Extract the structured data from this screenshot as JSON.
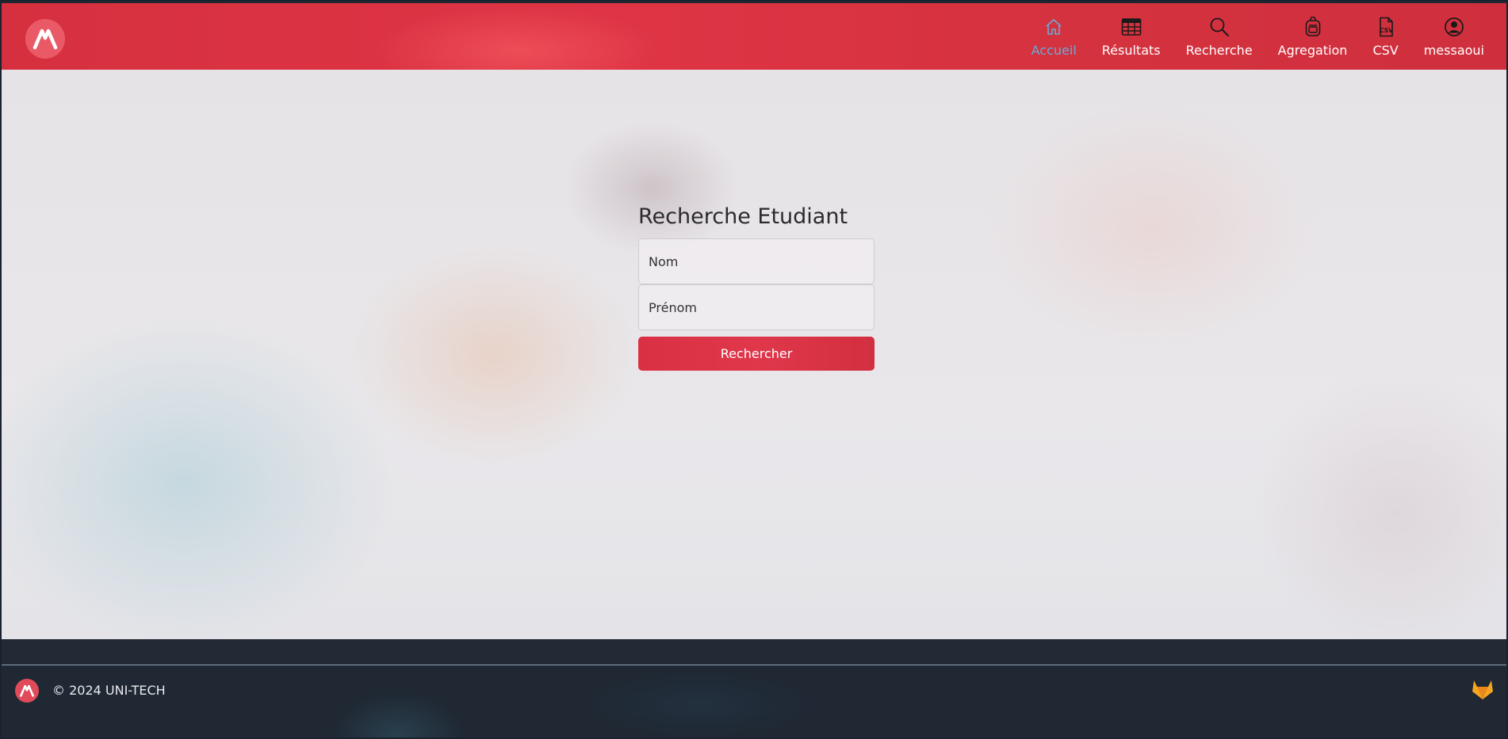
{
  "nav": {
    "items": [
      {
        "label": "Accueil",
        "icon": "home-icon",
        "active": true
      },
      {
        "label": "Résultats",
        "icon": "table-icon",
        "active": false
      },
      {
        "label": "Recherche",
        "icon": "search-icon",
        "active": false
      },
      {
        "label": "Agregation",
        "icon": "backpack-icon",
        "active": false
      },
      {
        "label": "CSV",
        "icon": "csv-file-icon",
        "active": false
      },
      {
        "label": "messaoui",
        "icon": "user-circle-icon",
        "active": false
      }
    ]
  },
  "search": {
    "title": "Recherche Etudiant",
    "nom_placeholder": "Nom",
    "prenom_placeholder": "Prénom",
    "button_label": "Rechercher"
  },
  "footer": {
    "copyright": "© 2024 UNI-TECH"
  },
  "colors": {
    "brand_red": "#dc3545",
    "active_nav": "#6aaad6",
    "footer_bg": "#1f2833",
    "gitlab_orange": "#f5a623"
  }
}
